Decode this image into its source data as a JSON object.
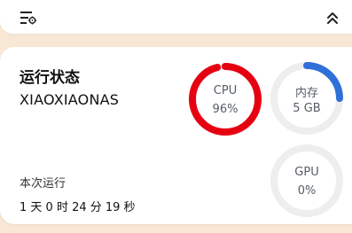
{
  "toolbar": {
    "filter_icon": "filter-settings-icon",
    "collapse_icon": "chevron-double-up-icon"
  },
  "status": {
    "title": "运行状态",
    "hostname": "XIAOXIAONAS",
    "uptime_label": "本次运行",
    "uptime_value": "1 天 0 时 24 分 19 秒"
  },
  "gauges": [
    {
      "label": "CPU",
      "value_text": "96%",
      "fraction": 0.96,
      "color": "#e60012"
    },
    {
      "label": "内存",
      "value_text": "5 GB",
      "fraction": 0.25,
      "color": "#2f6fd8"
    },
    {
      "label": "GPU",
      "value_text": "0%",
      "fraction": 0,
      "color": "#e6e6e6"
    }
  ],
  "colors": {
    "background": "#f8e7d4",
    "track": "#eeeeee"
  }
}
